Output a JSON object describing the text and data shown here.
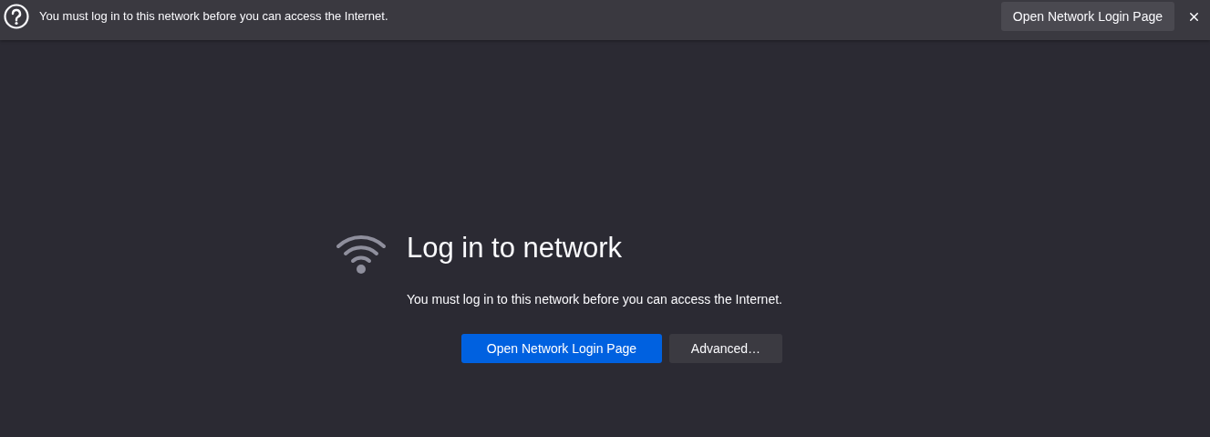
{
  "notification_bar": {
    "message": "You must log in to this network before you can access the Internet.",
    "button": "Open Network Login Page"
  },
  "content": {
    "title": "Log in to network",
    "description": "You must log in to this network before you can access the Internet.",
    "buttons": [
      {
        "label": "Open Network Login Page",
        "kind": "primary"
      },
      {
        "label": "Advanced…",
        "kind": "secondary"
      }
    ]
  }
}
